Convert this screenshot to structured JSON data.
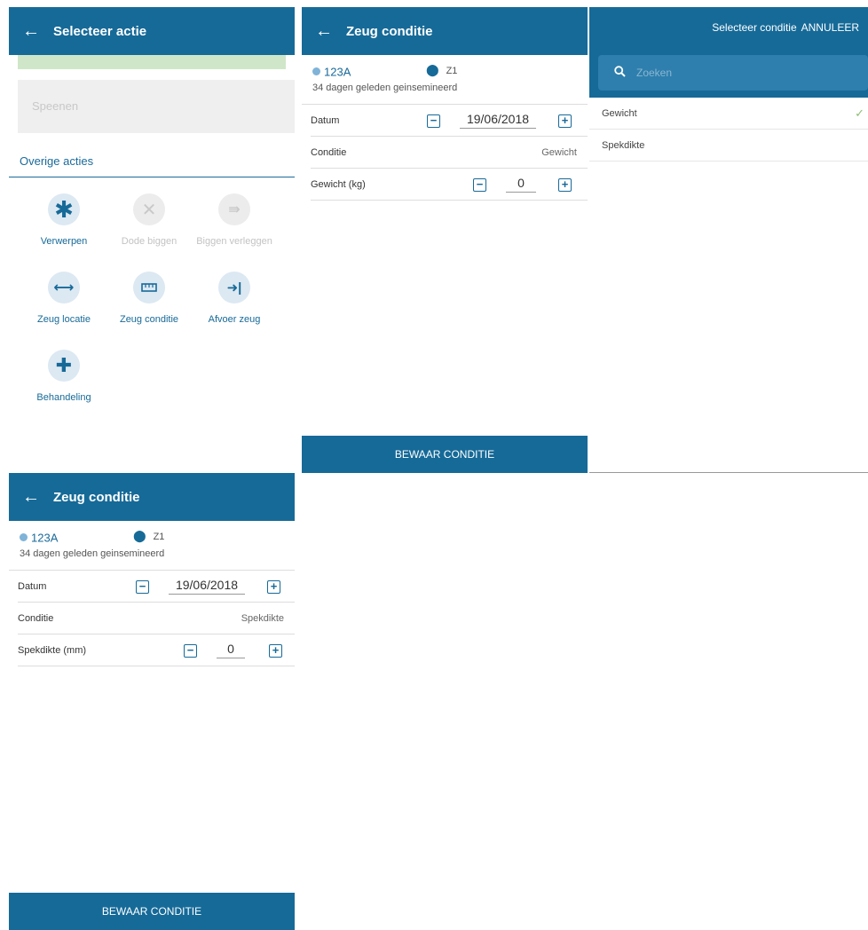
{
  "screen1": {
    "title": "Selecteer actie",
    "disabled_action": "Speenen",
    "section": "Overige acties",
    "actions": [
      {
        "label": "Verwerpen",
        "glyph": "✱"
      },
      {
        "label": "Dode biggen",
        "glyph": "✕"
      },
      {
        "label": "Biggen verleggen",
        "glyph": "⇛"
      },
      {
        "label": "Zeug locatie",
        "glyph": "⟷"
      },
      {
        "label": "Zeug conditie",
        "glyph": "▭"
      },
      {
        "label": "Afvoer zeug",
        "glyph": "➜|"
      },
      {
        "label": "Behandeling",
        "glyph": "✚"
      }
    ]
  },
  "screen2": {
    "title": "Zeug conditie",
    "tag": "123A",
    "location": "Z1",
    "subtitle": "34 dagen geleden geinsemineerd",
    "date_label": "Datum",
    "date_value": "19/06/2018",
    "condition_label": "Conditie",
    "condition_value": "Gewicht",
    "field_label": "Gewicht (kg)",
    "field_value": "0",
    "save": "BEWAAR CONDITIE"
  },
  "screen3": {
    "title": "Selecteer conditie",
    "cancel": "ANNULEER",
    "search_placeholder": "Zoeken",
    "options": [
      "Gewicht",
      "Spekdikte"
    ]
  },
  "screen4": {
    "title": "Zeug conditie",
    "tag": "123A",
    "location": "Z1",
    "subtitle": "34 dagen geleden geinsemineerd",
    "date_label": "Datum",
    "date_value": "19/06/2018",
    "condition_label": "Conditie",
    "condition_value": "Spekdikte",
    "field_label": "Spekdikte (mm)",
    "field_value": "0",
    "save": "BEWAAR CONDITIE"
  },
  "colors": {
    "primary": "#166a98",
    "accent_check": "#8dbf74",
    "green_strip": "#cfe7c8"
  }
}
